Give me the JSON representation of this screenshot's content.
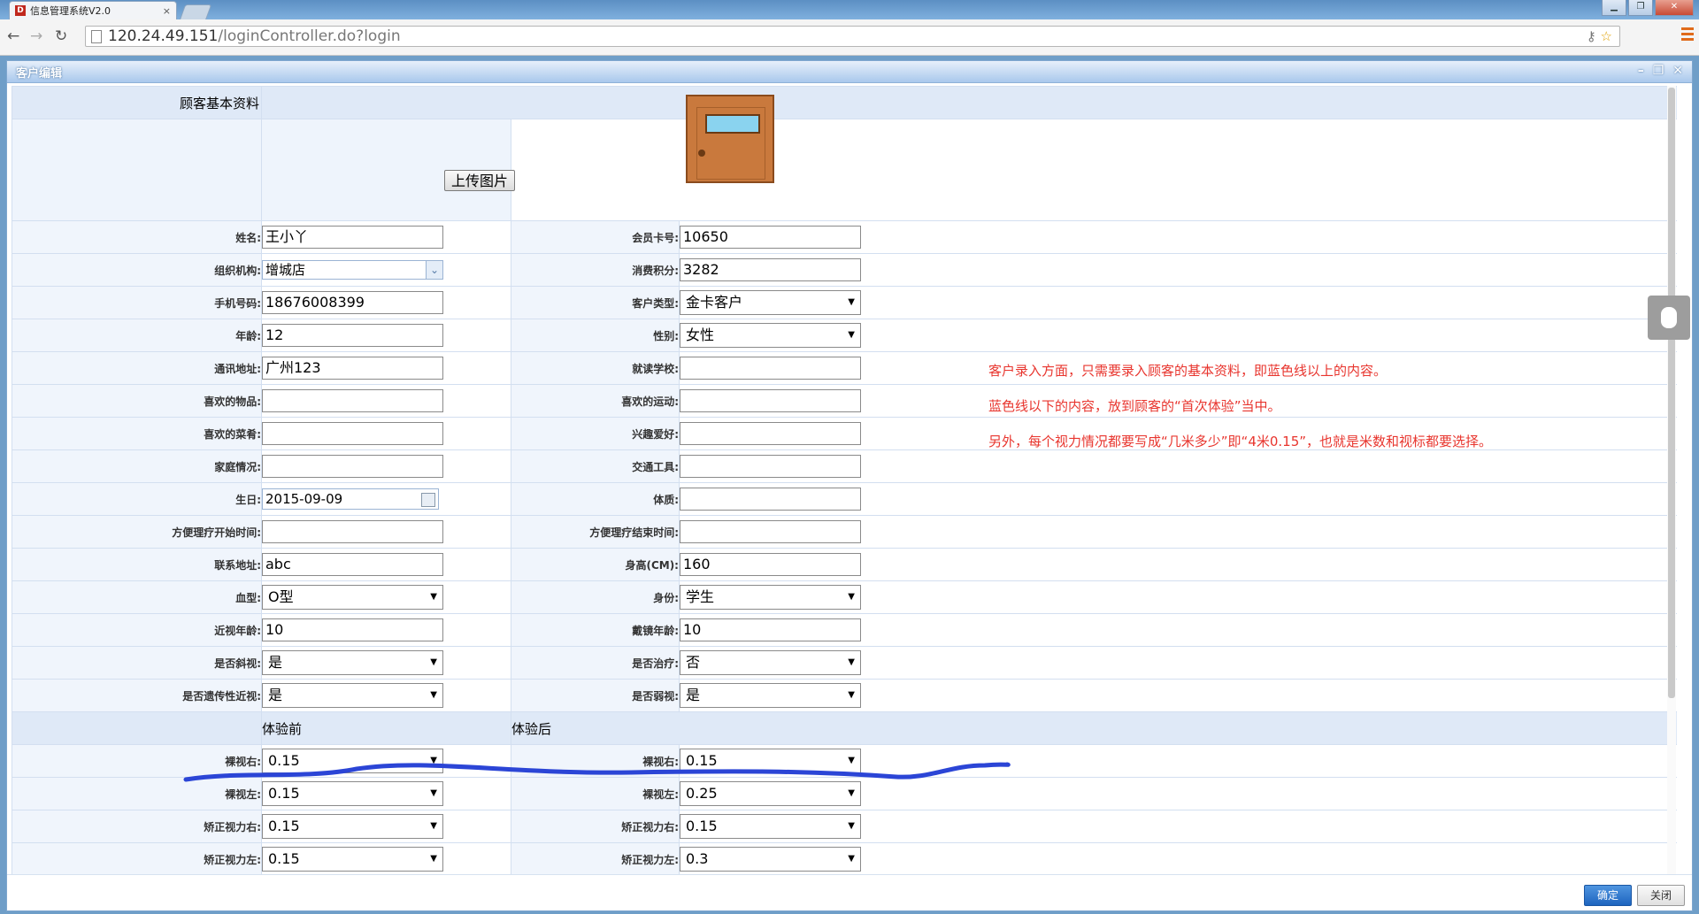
{
  "browser": {
    "tab_title": "信息管理系统V2.0",
    "tab_close": "×",
    "favicon": "D",
    "url_host": "120.24.49.151",
    "url_path": "/loginController.do?login",
    "icons": [
      "back-icon",
      "forward-icon",
      "reload-icon",
      "page-icon",
      "key-icon",
      "star-icon",
      "menu-icon"
    ]
  },
  "dialog": {
    "title": "客户编辑",
    "section_basic": "顾客基本资料",
    "upload_label": "上传图片",
    "section_before": "体验前",
    "section_after": "体验后",
    "ok_label": "确定",
    "close_label": "关闭"
  },
  "basic_rows": [
    {
      "l_label": "姓名:",
      "l_type": "input",
      "l_value": "王小丫",
      "r_label": "会员卡号:",
      "r_type": "input",
      "r_value": "10650"
    },
    {
      "l_label": "组织机构:",
      "l_type": "combo",
      "l_value": "增城店",
      "r_label": "消费积分:",
      "r_type": "input",
      "r_value": "3282"
    },
    {
      "l_label": "手机号码:",
      "l_type": "input",
      "l_value": "18676008399",
      "r_label": "客户类型:",
      "r_type": "select",
      "r_value": "金卡客户"
    },
    {
      "l_label": "年龄:",
      "l_type": "input",
      "l_value": "12",
      "r_label": "性别:",
      "r_type": "select",
      "r_value": "女性"
    },
    {
      "l_label": "通讯地址:",
      "l_type": "input",
      "l_value": "广州123",
      "r_label": "就读学校:",
      "r_type": "input",
      "r_value": ""
    },
    {
      "l_label": "喜欢的物品:",
      "l_type": "input",
      "l_value": "",
      "r_label": "喜欢的运动:",
      "r_type": "input",
      "r_value": ""
    },
    {
      "l_label": "喜欢的菜肴:",
      "l_type": "input",
      "l_value": "",
      "r_label": "兴趣爱好:",
      "r_type": "input",
      "r_value": ""
    },
    {
      "l_label": "家庭情况:",
      "l_type": "input",
      "l_value": "",
      "r_label": "交通工具:",
      "r_type": "input",
      "r_value": ""
    },
    {
      "l_label": "生日:",
      "l_type": "date",
      "l_value": "2015-09-09",
      "r_label": "体质:",
      "r_type": "input",
      "r_value": ""
    },
    {
      "l_label": "方便理疗开始时间:",
      "l_type": "input",
      "l_value": "",
      "r_label": "方便理疗结束时间:",
      "r_type": "input",
      "r_value": ""
    },
    {
      "l_label": "联系地址:",
      "l_type": "input",
      "l_value": "abc",
      "r_label": "身高(CM):",
      "r_type": "input",
      "r_value": "160"
    },
    {
      "l_label": "血型:",
      "l_type": "select",
      "l_value": "O型",
      "r_label": "身份:",
      "r_type": "select",
      "r_value": "学生"
    },
    {
      "l_label": "近视年龄:",
      "l_type": "input",
      "l_value": "10",
      "r_label": "戴镜年龄:",
      "r_type": "input",
      "r_value": "10"
    },
    {
      "l_label": "是否斜视:",
      "l_type": "select",
      "l_value": "是",
      "r_label": "是否治疗:",
      "r_type": "select",
      "r_value": "否"
    },
    {
      "l_label": "是否遗传性近视:",
      "l_type": "select",
      "l_value": "是",
      "r_label": "是否弱视:",
      "r_type": "select",
      "r_value": "是"
    }
  ],
  "vision_rows": [
    {
      "l_label": "裸视右:",
      "l_value": "0.15",
      "r_label": "裸视右:",
      "r_value": "0.15"
    },
    {
      "l_label": "裸视左:",
      "l_value": "0.15",
      "r_label": "裸视左:",
      "r_value": "0.25"
    },
    {
      "l_label": "矫正视力右:",
      "l_value": "0.15",
      "r_label": "矫正视力右:",
      "r_value": "0.15"
    },
    {
      "l_label": "矫正视力左:",
      "l_value": "0.15",
      "r_label": "矫正视力左:",
      "r_value": "0.3"
    }
  ],
  "notes": [
    "客户录入方面，只需要录入顾客的基本资料，即蓝色线以上的内容。",
    "蓝色线以下的内容，放到顾客的“首次体验”当中。",
    "另外，每个视力情况都要写成“几米多少”即“4米0.15”，也就是米数和视标都要选择。"
  ],
  "colors": {
    "annotation_red": "#e8352e",
    "underline_blue": "#2b45d6",
    "ok_button": "#1d64bf"
  }
}
